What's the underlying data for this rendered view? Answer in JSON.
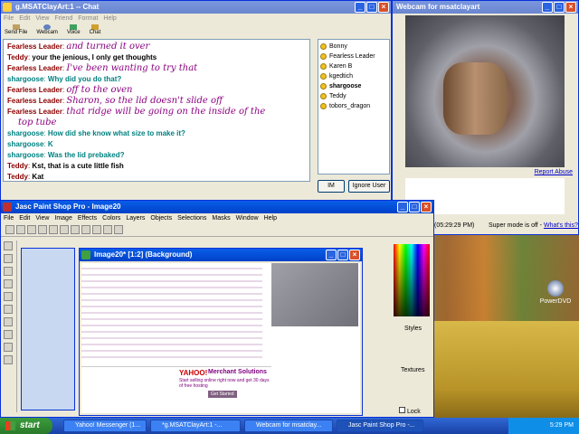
{
  "messenger": {
    "title": "g.MSATClayArt:1 -- Chat",
    "menu": [
      "File",
      "Edit",
      "View",
      "Friend",
      "Format",
      "Help"
    ],
    "toolbar": [
      "Send File",
      "Webcam",
      "Voice",
      "Chat"
    ],
    "messages": [
      {
        "who": "Fearless Leader",
        "cls": "fl",
        "text": "and turned it over"
      },
      {
        "who": "Teddy",
        "cls": "td",
        "text": "your the jenious, I only get thoughts"
      },
      {
        "who": "Fearless Leader",
        "cls": "fl",
        "text": "I've been wanting to try that"
      },
      {
        "who": "shargoose",
        "cls": "sg",
        "text": "Why did you do that?"
      },
      {
        "who": "Fearless Leader",
        "cls": "fl",
        "text": "off to the oven"
      },
      {
        "who": "Fearless Leader",
        "cls": "fl",
        "text": "Sharon, so the lid doesn't slide off"
      },
      {
        "who": "Fearless Leader",
        "cls": "fl",
        "text": "that ridge will be going on the inside of the"
      },
      {
        "who": "",
        "cls": "fl",
        "text": "top tube"
      },
      {
        "who": "shargoose",
        "cls": "sg",
        "text": "How did she know what size to make it?"
      },
      {
        "who": "shargoose",
        "cls": "sg",
        "text": "K"
      },
      {
        "who": "shargoose",
        "cls": "sg",
        "text": "Was the lid prebaked?"
      },
      {
        "who": "Teddy",
        "cls": "td",
        "text": "Kst, that is a cute little fish"
      },
      {
        "who": "Teddy",
        "cls": "td",
        "text": "Kat"
      }
    ],
    "buddies": [
      "Bonny",
      "Fearless Leader",
      "Karen B",
      "kgedtich",
      "shargoose",
      "Teddy",
      "tobors_dragon"
    ],
    "im_label": "IM",
    "ignore_label": "Ignore User"
  },
  "webcam": {
    "title": "Webcam for msatclayart",
    "report": "Report Abuse",
    "time": "(05:29:29 PM)",
    "supermode": "Super mode is off -",
    "whats": "What's this?"
  },
  "psp": {
    "title": "Jasc Paint Shop Pro - Image20",
    "menu": [
      "File",
      "Edit",
      "View",
      "Image",
      "Effects",
      "Colors",
      "Layers",
      "Objects",
      "Selections",
      "Masks",
      "Window",
      "Help"
    ],
    "inner_title": "Image20* [1:2] (Background)",
    "styles": "Styles",
    "textures": "Textures",
    "lock": "Lock",
    "ad_brand": "YAHOO!",
    "ad_head": "Merchant Solutions",
    "ad_sub": "Start selling online right now and get 30 days of free hosting",
    "ad_btn": "Get Started"
  },
  "desktop": {
    "icon_label": "PowerDVD"
  },
  "taskbar": {
    "start": "start",
    "tasks": [
      "Yahoo! Messenger (1...",
      "*g.MSATClayArt:1 -...",
      "Webcam for msatclay...",
      "Jasc Paint Shop Pro -..."
    ],
    "clock": "5:29 PM"
  }
}
